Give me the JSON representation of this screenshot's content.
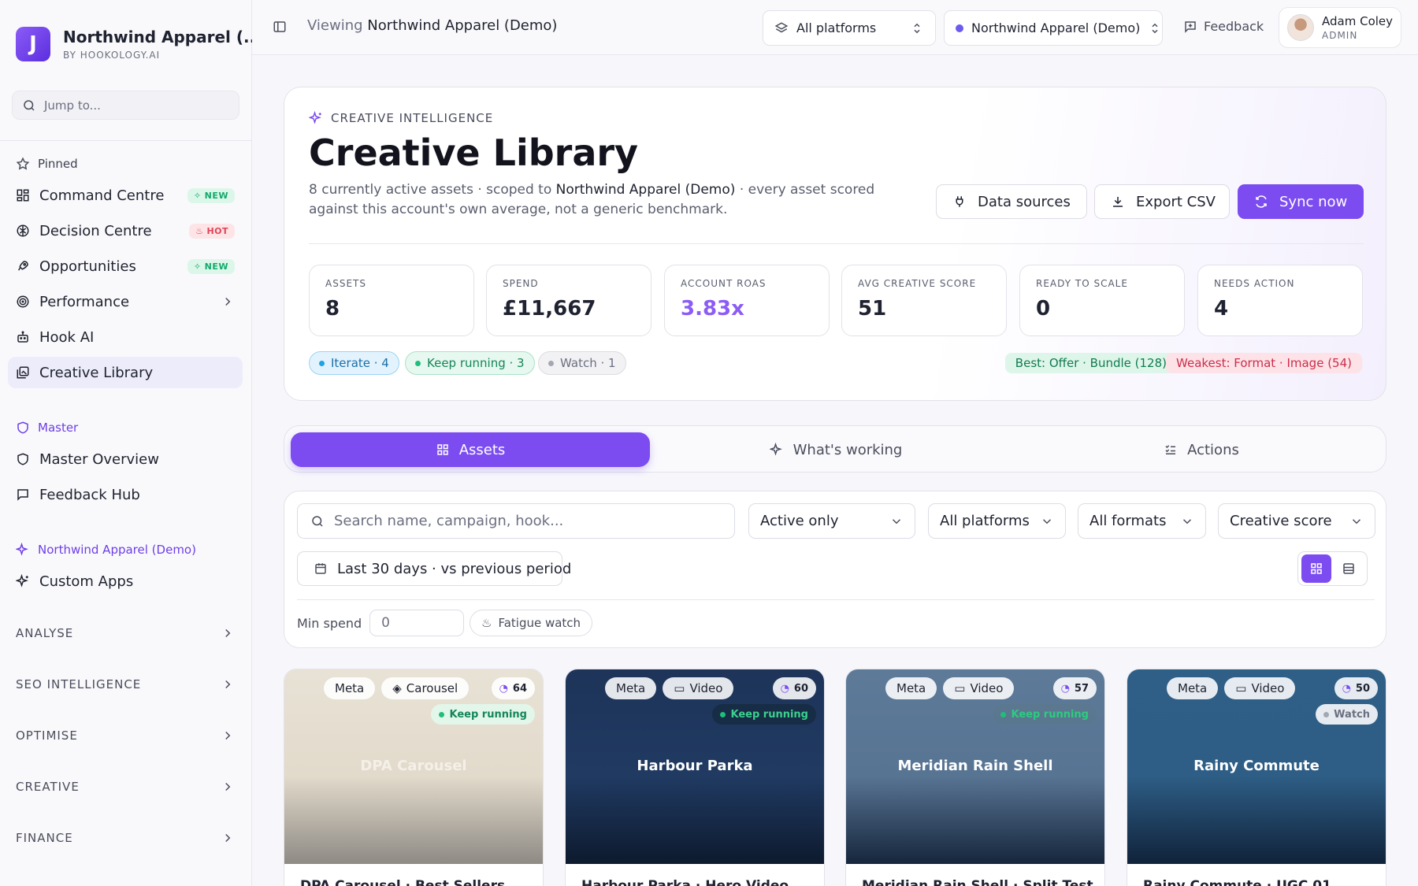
{
  "sidebar": {
    "brand": {
      "name": "Northwind Apparel (...",
      "sub": "BY HOOKOLOGY.AI",
      "logo": "J"
    },
    "jump_placeholder": "Jump to...",
    "pinned_label": "Pinned",
    "items": [
      {
        "label": "Command Centre",
        "badge": "NEW",
        "icon": "grid-icon"
      },
      {
        "label": "Decision Centre",
        "badge": "HOT",
        "icon": "brain-icon"
      },
      {
        "label": "Opportunities",
        "badge": "NEW",
        "icon": "rocket-icon"
      },
      {
        "label": "Performance",
        "icon": "target-icon"
      },
      {
        "label": "Hook AI",
        "icon": "bot-icon"
      },
      {
        "label": "Creative Library",
        "icon": "gallery-icon",
        "active": true
      }
    ],
    "master_label": "Master",
    "master_items": [
      {
        "label": "Master Overview",
        "icon": "shield-icon"
      },
      {
        "label": "Feedback Hub",
        "icon": "message-icon"
      }
    ],
    "account_label": "Northwind Apparel (Demo)",
    "account_items": [
      {
        "label": "Custom Apps",
        "icon": "sparkle-icon"
      }
    ],
    "sections": [
      "ANALYSE",
      "SEO INTELLIGENCE",
      "OPTIMISE",
      "CREATIVE",
      "FINANCE"
    ]
  },
  "topbar": {
    "viewing_prefix": "Viewing",
    "viewing_account": "Northwind Apparel (Demo)",
    "platform_select": "All platforms",
    "account_select": "Northwind Apparel (Demo)",
    "feedback": "Feedback",
    "user_name": "Adam Coley",
    "user_role": "ADMIN"
  },
  "hero": {
    "eyebrow": "CREATIVE INTELLIGENCE",
    "title": "Creative Library",
    "desc_a": "8 currently active assets · scoped to",
    "desc_account": "Northwind Apparel (Demo)",
    "desc_b": "· every asset scored against this account's own average, not a generic benchmark.",
    "buttons": {
      "data_sources": "Data sources",
      "export": "Export CSV",
      "sync": "Sync now"
    },
    "stats": [
      {
        "label": "ASSETS",
        "value": "8"
      },
      {
        "label": "SPEND",
        "value": "£11,667"
      },
      {
        "label": "ACCOUNT ROAS",
        "value": "3.83x"
      },
      {
        "label": "AVG CREATIVE SCORE",
        "value": "51"
      },
      {
        "label": "READY TO SCALE",
        "value": "0"
      },
      {
        "label": "NEEDS ACTION",
        "value": "4"
      }
    ],
    "chips": {
      "iterate": "Iterate · 4",
      "keep": "Keep running · 3",
      "watch": "Watch · 1"
    },
    "best": "Best: Offer · Bundle (128)",
    "weak": "Weakest: Format · Image (54)"
  },
  "tabs": {
    "assets": "Assets",
    "working": "What's working",
    "actions": "Actions"
  },
  "filters": {
    "search_placeholder": "Search name, campaign, hook...",
    "status": "Active only",
    "platforms": "All platforms",
    "formats": "All formats",
    "sort": "Creative score",
    "date": "Last 30 days · vs previous period",
    "min_spend_label": "Min spend",
    "min_spend_value": "0",
    "fatigue": "Fatigue watch"
  },
  "cards": [
    {
      "platform": "Meta",
      "format": "Carousel",
      "score": "64",
      "status": "Keep running",
      "thumb_title": "DPA Carousel",
      "name": "DPA Carousel · Best Sellers"
    },
    {
      "platform": "Meta",
      "format": "Video",
      "score": "60",
      "status": "Keep running",
      "thumb_title": "Harbour Parka",
      "name": "Harbour Parka · Hero Video"
    },
    {
      "platform": "Meta",
      "format": "Video",
      "score": "57",
      "status": "Keep running",
      "thumb_title": "Meridian Rain Shell",
      "name": "Meridian Rain Shell · Split Test"
    },
    {
      "platform": "Meta",
      "format": "Video",
      "score": "50",
      "status": "Watch",
      "thumb_title": "Rainy Commute",
      "name": "Rainy Commute · UGC 01"
    }
  ],
  "colors": {
    "accent": "#7c4cf0",
    "keep": "#1fbf7a",
    "iterate": "#1ea2e8",
    "weak": "#cc2d4a"
  }
}
